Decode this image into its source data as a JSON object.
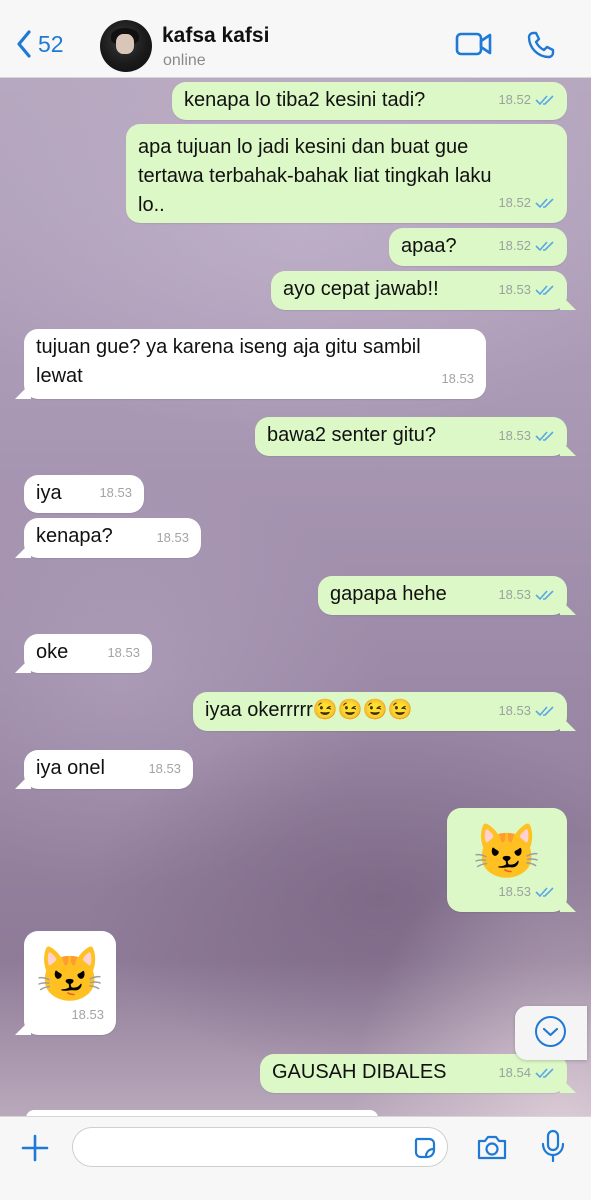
{
  "header": {
    "back_count": "52",
    "contact_name": "kafsa kafsi",
    "status": "online",
    "accent_color": "#1f7ad6"
  },
  "messages": [
    {
      "dir": "out",
      "text": "kenapa lo tiba2 kesini tadi?",
      "time": "18.52",
      "ticks": "double"
    },
    {
      "dir": "out",
      "text": "apa tujuan lo jadi kesini dan buat gue\ntertawa terbahak-bahak liat tingkah laku\nlo..",
      "time": "18.52",
      "ticks": "double"
    },
    {
      "dir": "out",
      "text": "apaa?",
      "time": "18.52",
      "ticks": "double"
    },
    {
      "dir": "out",
      "text": "ayo cepat jawab!!",
      "time": "18.53",
      "ticks": "double"
    },
    {
      "dir": "in",
      "text": "tujuan gue? ya karena iseng aja gitu sambil\nlewat",
      "time": "18.53"
    },
    {
      "dir": "out",
      "text": "bawa2 senter gitu?",
      "time": "18.53",
      "ticks": "double"
    },
    {
      "dir": "in",
      "text": "iya",
      "time": "18.53"
    },
    {
      "dir": "in",
      "text": "kenapa?",
      "time": "18.53"
    },
    {
      "dir": "out",
      "text": "gapapa hehe",
      "time": "18.53",
      "ticks": "double"
    },
    {
      "dir": "in",
      "text": "oke",
      "time": "18.53"
    },
    {
      "dir": "out",
      "text": "iyaa okerrrrr😉😉😉😉",
      "time": "18.53",
      "ticks": "double"
    },
    {
      "dir": "in",
      "text": "iya onel",
      "time": "18.53"
    },
    {
      "dir": "out",
      "text": "😼",
      "time": "18.53",
      "ticks": "double"
    },
    {
      "dir": "in",
      "text": "😼",
      "time": "18.53"
    },
    {
      "dir": "out",
      "text": "GAUSAH DIBALES",
      "time": "18.54",
      "ticks": "double"
    }
  ],
  "composer": {
    "placeholder": ""
  },
  "icons": [
    "back-chevron-icon",
    "video-call-icon",
    "phone-icon",
    "scroll-down-icon",
    "plus-icon",
    "sticker-icon",
    "camera-icon",
    "microphone-icon",
    "double-check-icon"
  ]
}
